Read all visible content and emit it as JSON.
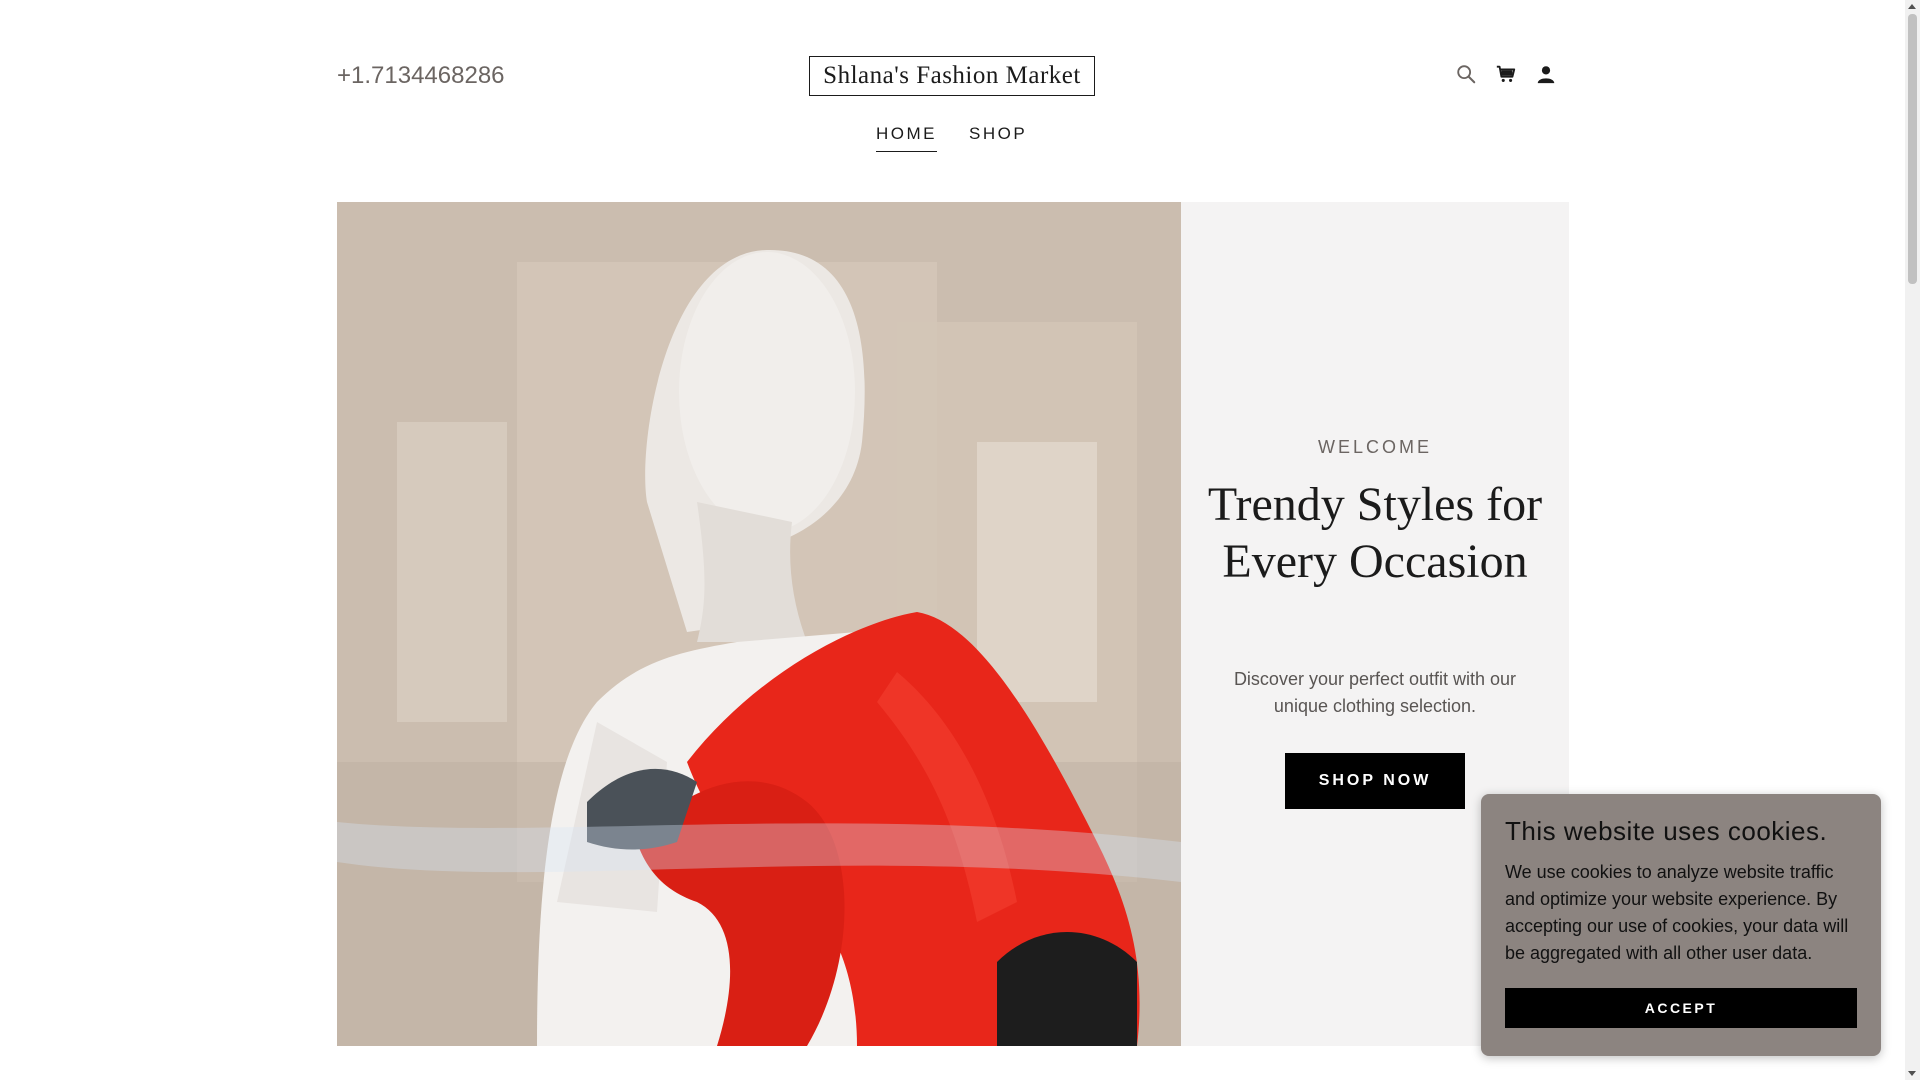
{
  "header": {
    "phone": "+1.7134468286",
    "logo": "Shlana's Fashion Market",
    "icons": [
      "search-icon",
      "cart-icon",
      "account-icon"
    ]
  },
  "nav": {
    "items": [
      {
        "label": "HOME",
        "active": true
      },
      {
        "label": "SHOP",
        "active": false
      }
    ]
  },
  "hero": {
    "eyebrow": "WELCOME",
    "title": "Trendy Styles for Every Occasion",
    "subtitle": "Discover your perfect outfit with our unique clothing selection.",
    "cta": "SHOP NOW"
  },
  "cookie": {
    "title": "This website uses cookies.",
    "text": "We use cookies to analyze website traffic and optimize your website experience. By accepting our use of cookies, your data will be aggregated with all other user data.",
    "accept": "ACCEPT"
  },
  "colors": {
    "accent": "#000000",
    "panel": "#f4f3f3",
    "cookie_bg": "#8c8480",
    "muted_text": "#6b6562",
    "jacket_red": "#e8261a"
  }
}
